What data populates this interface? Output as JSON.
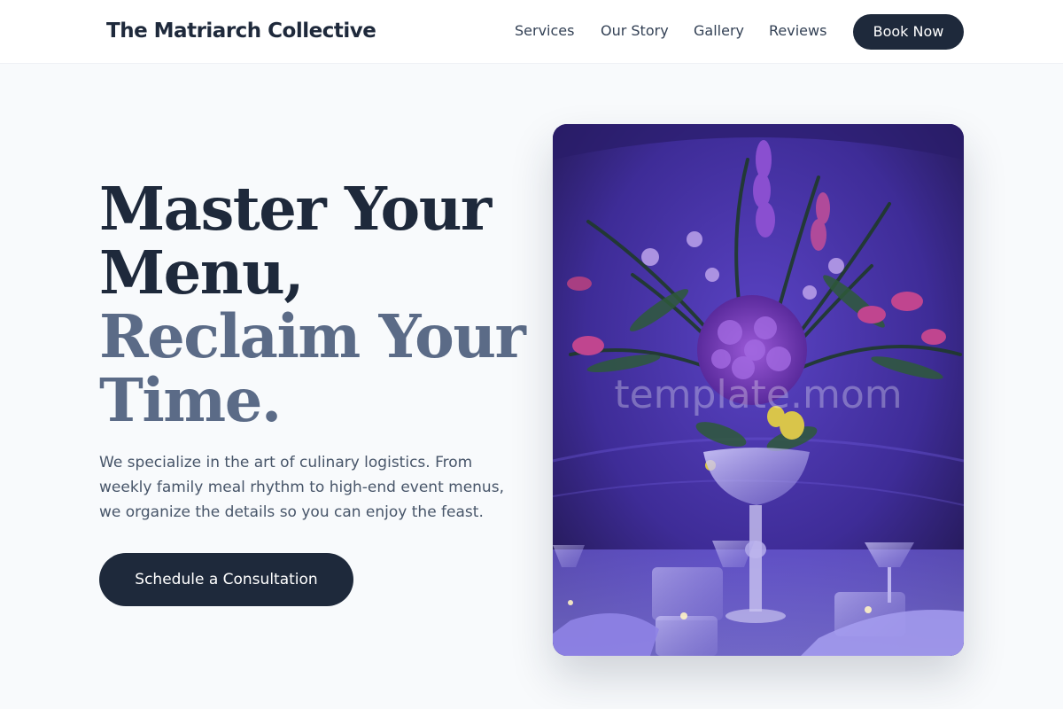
{
  "header": {
    "brand": "The Matriarch Collective",
    "nav": {
      "services": "Services",
      "our_story": "Our Story",
      "gallery": "Gallery",
      "reviews": "Reviews"
    },
    "book_now": "Book Now"
  },
  "hero": {
    "headline": {
      "line1": "Master Your",
      "line2": "Menu,",
      "line3": "Reclaim Your",
      "line4": "Time."
    },
    "intro": "We specialize in the art of culinary logistics. From weekly family meal rhythm to high-end event menus, we organize the details so you can enjoy the feast.",
    "cta": "Schedule a Consultation",
    "image": {
      "watermark": "template.mom"
    }
  },
  "colors": {
    "primary": "#1e293b",
    "muted_heading": "#5b6b87",
    "body_text": "#475569",
    "page_bg": "#f8fafc",
    "image_tone": "#3b2a8a"
  }
}
